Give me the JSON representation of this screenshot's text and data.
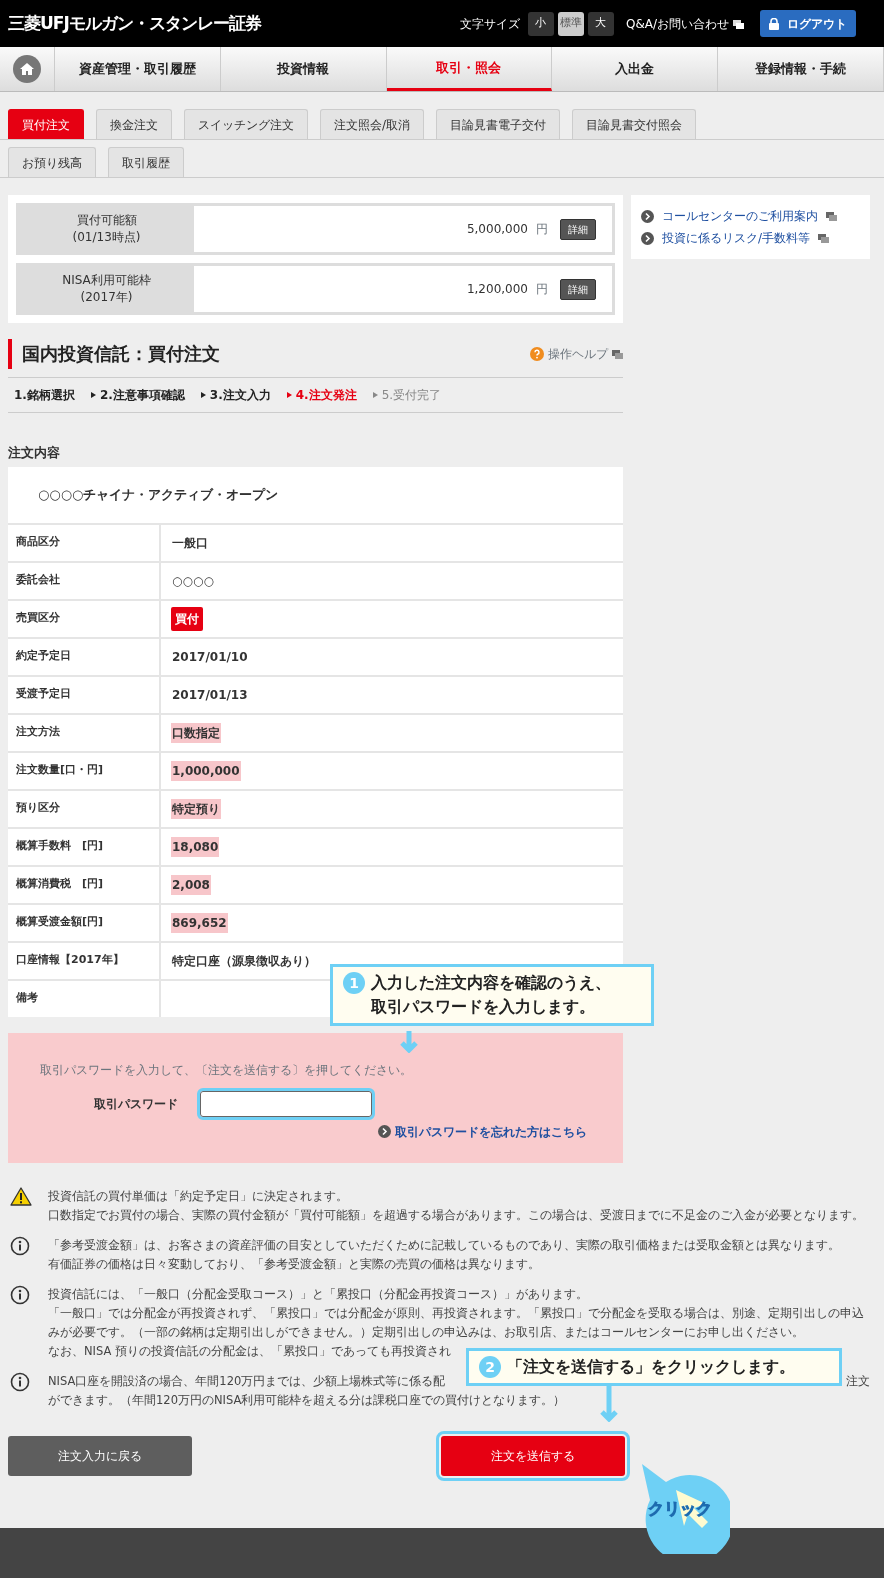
{
  "header": {
    "logo": "三菱UFJモルガン・スタンレー証券",
    "font_size_label": "文字サイズ",
    "font_sizes": [
      {
        "label": "小",
        "selected": false
      },
      {
        "label": "標準",
        "selected": true
      },
      {
        "label": "大",
        "selected": false
      }
    ],
    "help_link": "Q&A/お問い合わせ",
    "logout_button": "ログアウト"
  },
  "nav": [
    {
      "label": "資産管理・取引履歴",
      "selected": false
    },
    {
      "label": "投資情報",
      "selected": false
    },
    {
      "label": "取引・照会",
      "selected": true
    },
    {
      "label": "入出金",
      "selected": false
    },
    {
      "label": "登録情報・手続",
      "selected": false
    }
  ],
  "tabs": [
    {
      "label": "買付注文",
      "selected": true
    },
    {
      "label": "換金注文",
      "selected": false
    },
    {
      "label": "スイッチング注文",
      "selected": false
    },
    {
      "label": "注文照会/取消",
      "selected": false
    },
    {
      "label": "目論見書電子交付",
      "selected": false
    },
    {
      "label": "目論見書交付照会",
      "selected": false
    }
  ],
  "tabs_row2": [
    {
      "label": "お預り残高",
      "selected": false
    },
    {
      "label": "取引履歴",
      "selected": false
    }
  ],
  "balances": [
    {
      "label": "買付可能額",
      "sublabel": "(01/13時点)",
      "amount": "5,000,000",
      "unit": "円",
      "button": "詳細"
    },
    {
      "label": "NISA利用可能枠",
      "sublabel": "(2017年)",
      "amount": "1,200,000",
      "unit": "円",
      "button": "詳細"
    }
  ],
  "side_links": [
    "コールセンターのご利用案内",
    "投資に係るリスク/手数料等"
  ],
  "page_title": "国内投資信託：買付注文",
  "help_link": "操作ヘルプ",
  "steps": [
    {
      "label": "1.銘柄選択",
      "selected": false,
      "disabled": false
    },
    {
      "label": "2.注意事項確認",
      "selected": false,
      "disabled": false
    },
    {
      "label": "3.注文入力",
      "selected": false,
      "disabled": false
    },
    {
      "label": "4.注文発注",
      "selected": true,
      "disabled": false
    },
    {
      "label": "5.受付完了",
      "selected": false,
      "disabled": true
    }
  ],
  "order": {
    "heading": "注文内容",
    "fund_name": "○○○○チャイナ・アクティブ・オープン",
    "rows": [
      {
        "label": "商品区分",
        "value": "一般口",
        "kind": "text",
        "highlight": false
      },
      {
        "label": "委託会社",
        "value": "○○○○",
        "kind": "text",
        "highlight": false
      },
      {
        "label": "売買区分",
        "value": "買付",
        "kind": "badge"
      },
      {
        "label": "約定予定日",
        "value": "2017/01/10",
        "kind": "text",
        "highlight": false
      },
      {
        "label": "受渡予定日",
        "value": "2017/01/13",
        "kind": "text",
        "highlight": false
      },
      {
        "label": "注文方法",
        "value": "口数指定",
        "kind": "text",
        "highlight": true
      },
      {
        "label": "注文数量[口・円]",
        "value": "1,000,000",
        "kind": "text",
        "highlight": true
      },
      {
        "label": "預り区分",
        "value": "特定預り",
        "kind": "text",
        "highlight": true
      },
      {
        "label": "概算手数料　[円]",
        "value": "18,080",
        "kind": "text",
        "highlight": true
      },
      {
        "label": "概算消費税　[円]",
        "value": "2,008",
        "kind": "text",
        "highlight": true
      },
      {
        "label": "概算受渡金額[円]",
        "value": "869,652",
        "kind": "text",
        "highlight": true
      },
      {
        "label": "口座情報【2017年】",
        "value": "特定口座（源泉徴収あり）",
        "kind": "text",
        "highlight": false
      },
      {
        "label": "備考",
        "kind": "text"
      }
    ]
  },
  "password": {
    "instruction": "取引パスワードを入力して、〔注文を送信する〕を押してください。",
    "label": "取引パスワード",
    "forgot_link": "取引パスワードを忘れた方はこちら"
  },
  "notes": [
    {
      "kind": "warning",
      "lines": [
        "投資信託の買付単価は「約定予定日」に決定されます。",
        "口数指定でお買付の場合、実際の買付金額が「買付可能額」を超過する場合があります。この場合は、受渡日までに不足金のご入金が必要となります。"
      ]
    },
    {
      "kind": "info",
      "lines": [
        "「参考受渡金額」は、お客さまの資産評価の目安としていただくために記載しているものであり、実際の取引価格または受取金額とは異なります。",
        "有価証券の価格は日々変動しており、「参考受渡金額」と実際の売買の価格は異なります。"
      ]
    },
    {
      "kind": "info",
      "lines": [
        "投資信託には、「一般口（分配金受取コース）」と「累投口（分配金再投資コース）」があります。",
        "「一般口」では分配金が再投資されず、「累投口」では分配金が原則、再投資されます。「累投口」で分配金を受取る場合は、別途、定期引出しの申込みが必要です。（一部の銘柄は定期引出しができません。）定期引出しの申込みは、お取引店、またはコールセンターにお申し出ください。",
        "なお、NISA 預りの投資信託の分配金は、「累投口」であっても再投資され"
      ]
    },
    {
      "kind": "info",
      "lines": [
        "NISA口座を開設済の場合、年間120万円までは、少額上場株式等に係る配",
        "注文",
        "ができます。（年間120万円のNISA利用可能枠を超える分は課税口座での買付けとなります。）"
      ]
    }
  ],
  "buttons": {
    "back": "注文入力に戻る",
    "submit": "注文を送信する"
  },
  "callouts": [
    {
      "number": "1",
      "lines": [
        "入力した注文内容を確認のうえ、",
        "取引パスワードを入力します。"
      ]
    },
    {
      "number": "2",
      "lines": [
        "「注文を送信する」をクリックします。"
      ]
    }
  ],
  "click_badge": "クリック"
}
